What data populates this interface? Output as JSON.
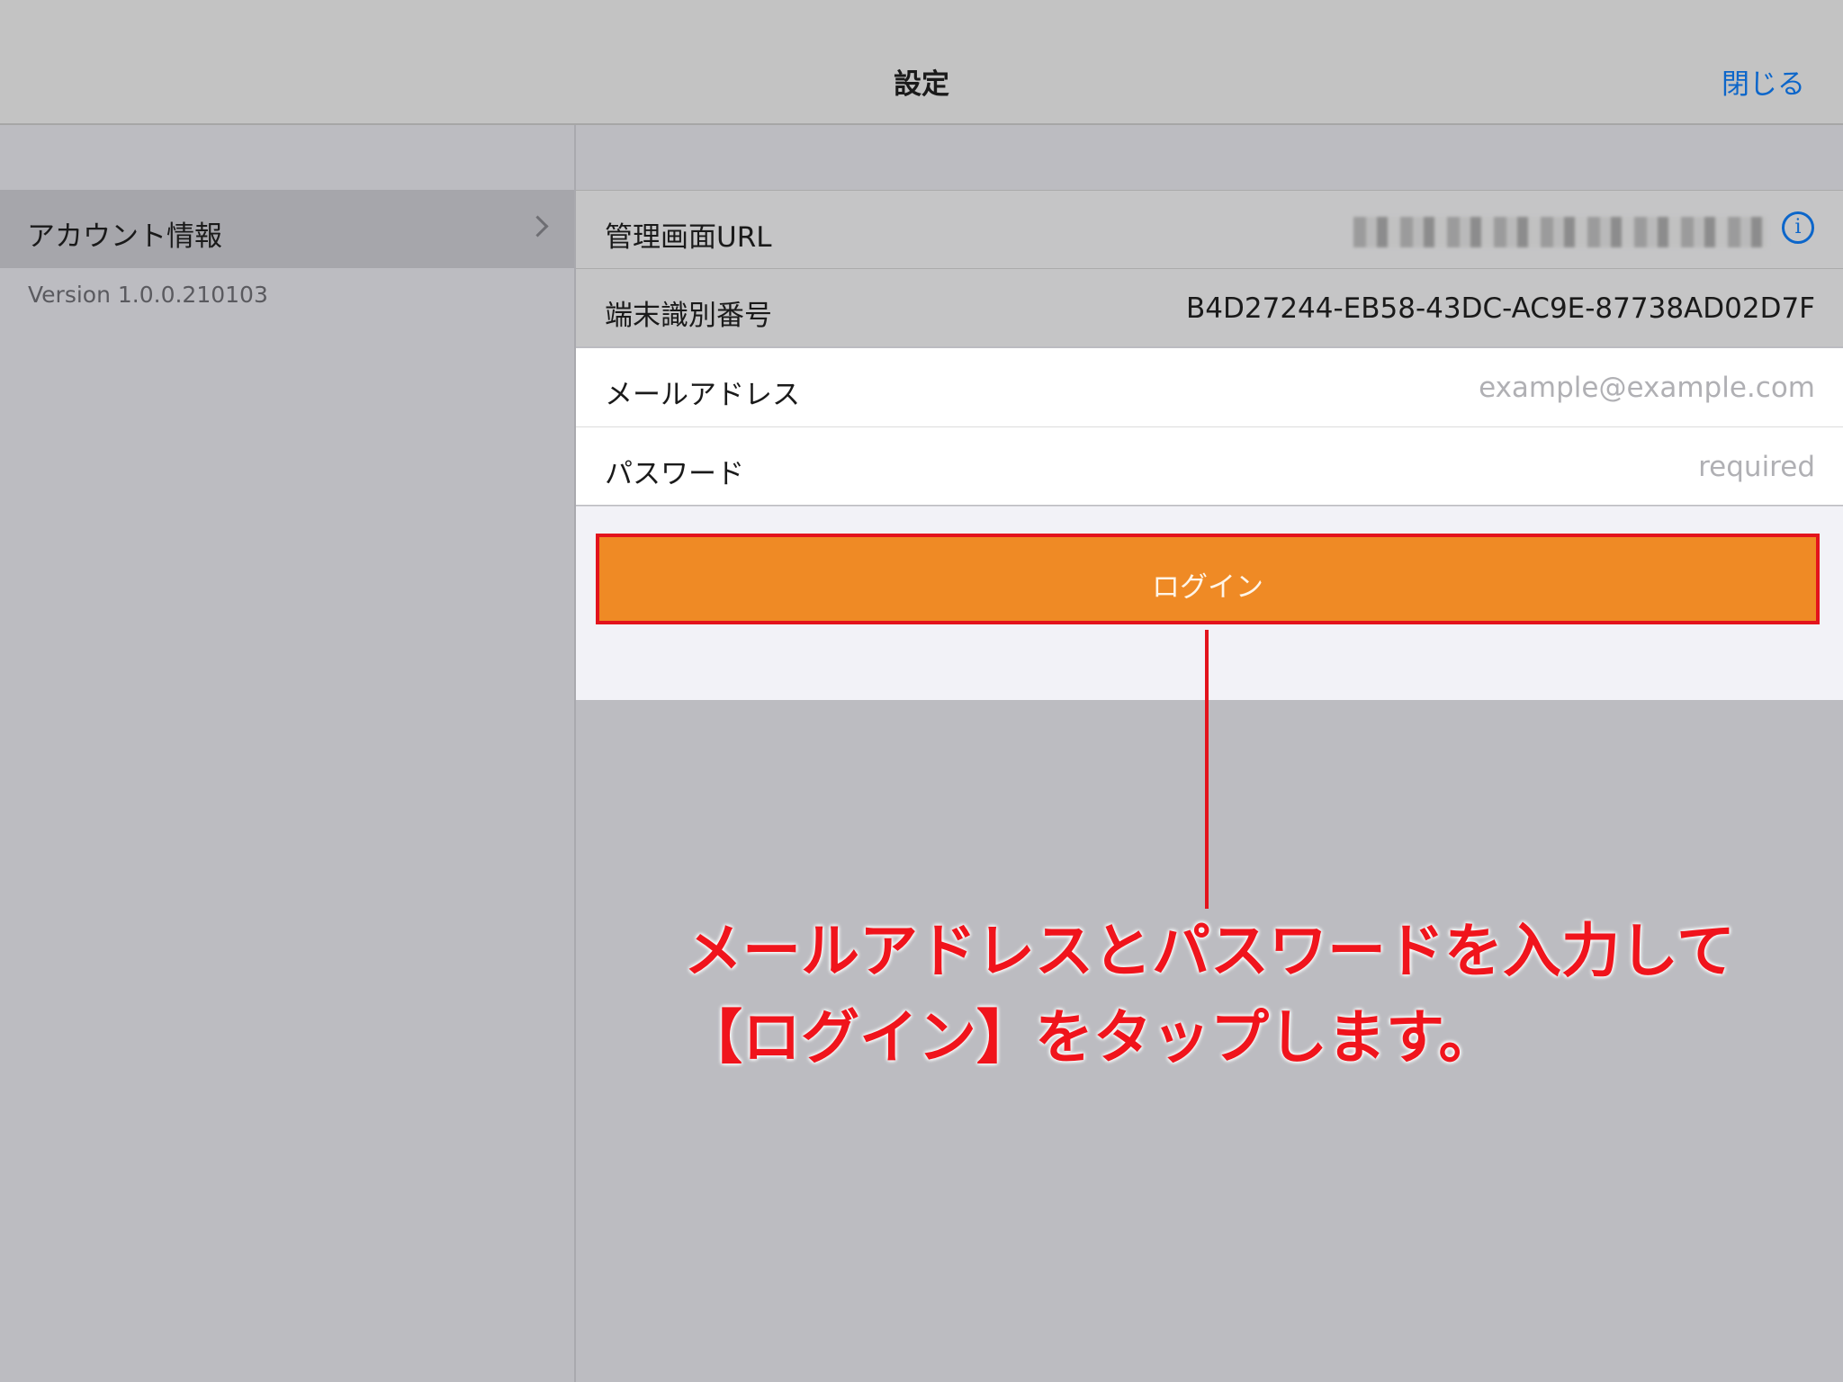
{
  "navbar": {
    "title": "設定",
    "close_label": "閉じる"
  },
  "sidebar": {
    "items": [
      {
        "label": "アカウント情報"
      }
    ],
    "version": "Version 1.0.0.210103"
  },
  "detail": {
    "admin_url": {
      "label": "管理画面URL"
    },
    "device_id": {
      "label": "端末識別番号",
      "value": "B4D27244-EB58-43DC-AC9E-87738AD02D7F"
    },
    "email": {
      "label": "メールアドレス",
      "placeholder": "example@example.com"
    },
    "password": {
      "label": "パスワード",
      "placeholder": "required"
    },
    "login_label": "ログイン"
  },
  "annotation": {
    "line1": "メールアドレスとパスワードを入力して",
    "line2": "【ログイン】をタップします。"
  },
  "colors": {
    "accent_blue": "#0c66ca",
    "login_orange": "#ef8a25",
    "annotation_red": "#e3131c"
  }
}
